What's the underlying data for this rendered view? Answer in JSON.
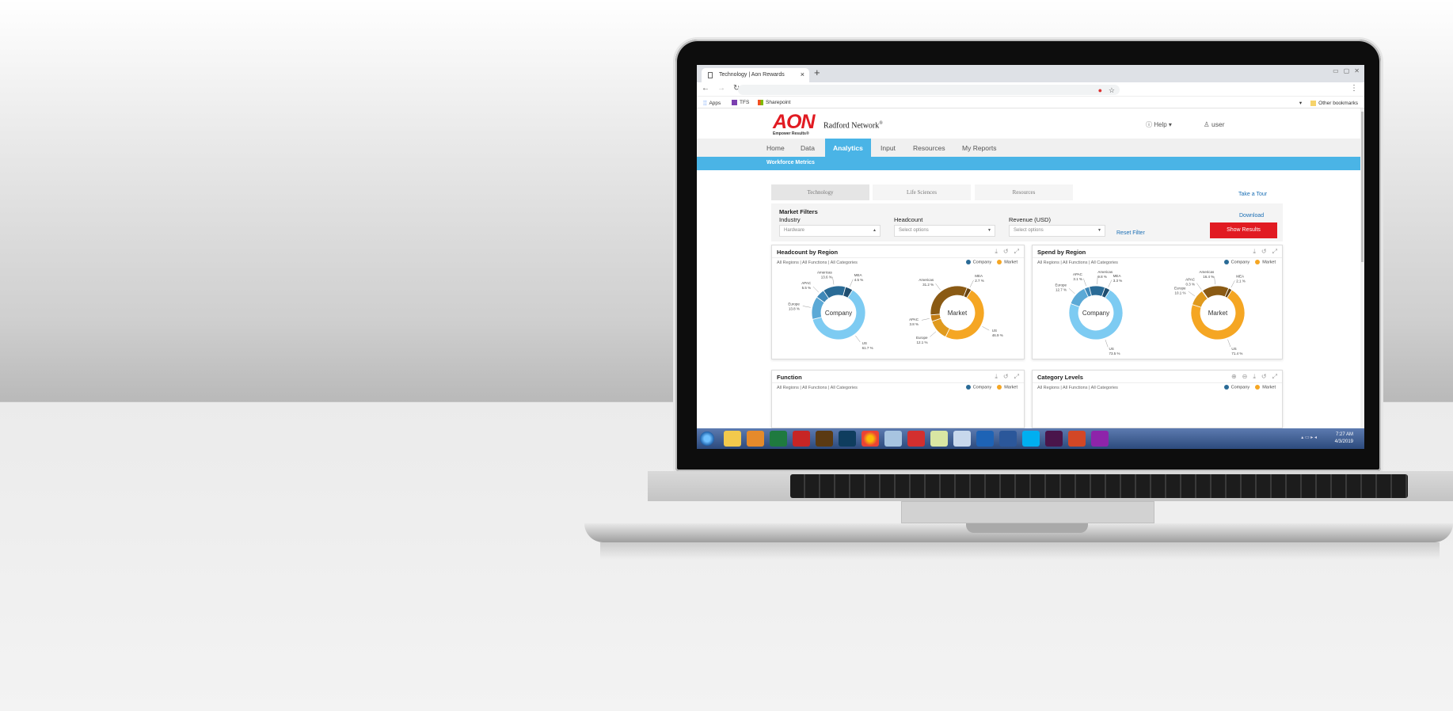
{
  "browser": {
    "tab_title": "Technology | Aon Rewards",
    "new_tab": "+",
    "close": "×",
    "bookmarks": [
      "Apps",
      "TFS",
      "Sharepoint"
    ],
    "other_bookmarks": "Other bookmarks"
  },
  "header": {
    "logo": "AON",
    "tagline": "Empower Results®",
    "network": "Radford Network",
    "network_mark": "®",
    "help": "Help",
    "user": "user"
  },
  "nav": {
    "items": [
      "Home",
      "Data",
      "Analytics",
      "Input",
      "Resources",
      "My Reports"
    ],
    "active": "Analytics"
  },
  "subbar": {
    "label": "Workforce Metrics"
  },
  "industry_tabs": [
    "Technology",
    "Life Sciences",
    "Resources"
  ],
  "take_tour": "Take a Tour",
  "filters": {
    "title": "Market Filters",
    "industry_label": "Industry",
    "industry_value": "Hardware",
    "headcount_label": "Headcount",
    "headcount_value": "Select options",
    "revenue_label": "Revenue (USD)",
    "revenue_value": "Select options",
    "reset": "Reset Filter",
    "download": "Download",
    "show_results": "Show Results"
  },
  "legend": {
    "company": "Company",
    "market": "Market"
  },
  "colors": {
    "accent": "#4ab4e6",
    "brand_red": "#e11b22",
    "company_palette": [
      "#7dcbf2",
      "#5ba9d6",
      "#3f88b8",
      "#2a6b96",
      "#1f4e70"
    ],
    "market_palette": [
      "#f5a623",
      "#e09a1e",
      "#c27c15",
      "#8a5a14",
      "#6b4510"
    ]
  },
  "panels": [
    {
      "title": "Headcount by Region",
      "subtitle": "All Regions | All Functions | All Categories"
    },
    {
      "title": "Spend by Region",
      "subtitle": "All Regions | All Functions | All Categories"
    },
    {
      "title": "Function",
      "subtitle": "All Regions | All Functions | All Categories"
    },
    {
      "title": "Category Levels",
      "subtitle": "All Regions | All Functions | All Categories"
    }
  ],
  "chart_data": [
    {
      "type": "pie",
      "title": "Headcount by Region",
      "center": "Company",
      "labels": [
        "US",
        "Europe",
        "APAC",
        "Americas",
        "MEA"
      ],
      "values": [
        61.7,
        13.8,
        5.5,
        13.6,
        4.5
      ],
      "data_labels": [
        "US\n61.7 %",
        "Europe\n13.8 %",
        "APAC\n5.5 %",
        "Americas\n13.6 %",
        "MEA\n4.5 %"
      ]
    },
    {
      "type": "pie",
      "title": "Headcount by Region",
      "center": "Market",
      "labels": [
        "US",
        "Europe",
        "APAC",
        "Americas",
        "MEA"
      ],
      "values": [
        46.9,
        12.1,
        3.8,
        31.2,
        2.7
      ],
      "data_labels": [
        "US\n46.9 %",
        "Europe\n12.1 %",
        "APAC\n3.8 %",
        "Americas\n31.2 %",
        "MEA\n2.7 %"
      ]
    },
    {
      "type": "pie",
      "title": "Spend by Region",
      "center": "Company",
      "labels": [
        "US",
        "Europe",
        "APAC",
        "Americas",
        "MEA"
      ],
      "values": [
        73.5,
        12.7,
        3.1,
        9.8,
        3.3
      ],
      "data_labels": [
        "US\n73.5 %",
        "Europe\n12.7 %",
        "APAC\n3.1 %",
        "Americas\n9.8 %",
        "MEA\n3.3 %"
      ]
    },
    {
      "type": "pie",
      "title": "Spend by Region",
      "center": "Market",
      "labels": [
        "US",
        "Europe",
        "APAC",
        "Americas",
        "MEA"
      ],
      "values": [
        71.4,
        10.1,
        0.3,
        16.4,
        2.1
      ],
      "data_labels": [
        "US\n71.4 %",
        "Europe\n10.1 %",
        "APAC\n0.3 %",
        "Americas\n16.4 %",
        "MEA\n2.1 %"
      ]
    }
  ],
  "taskbar": {
    "time": "7:27 AM",
    "date": "4/3/2019"
  }
}
